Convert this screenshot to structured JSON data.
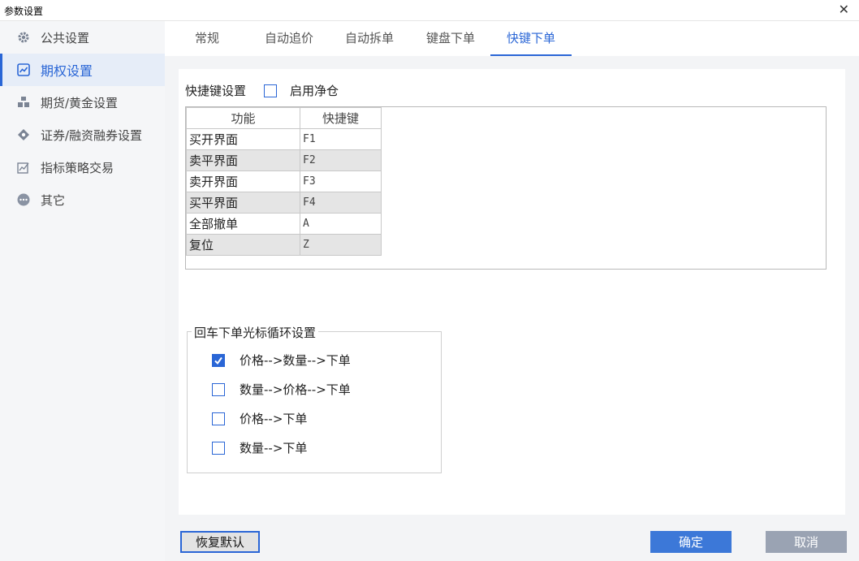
{
  "window": {
    "title": "参数设置",
    "close_glyph": "✕"
  },
  "sidebar": {
    "items": [
      {
        "label": "公共设置",
        "icon": "gear-icon"
      },
      {
        "label": "期权设置",
        "icon": "options-chart-icon",
        "active": true
      },
      {
        "label": "期货/黄金设置",
        "icon": "futures-icon"
      },
      {
        "label": "证券/融资融券设置",
        "icon": "securities-icon"
      },
      {
        "label": "指标策略交易",
        "icon": "strategy-chart-icon"
      },
      {
        "label": "其它",
        "icon": "more-icon"
      }
    ]
  },
  "tabs": [
    {
      "label": "常规"
    },
    {
      "label": "自动追价"
    },
    {
      "label": "自动拆单"
    },
    {
      "label": "键盘下单"
    },
    {
      "label": "快键下单",
      "active": true
    }
  ],
  "hotkey": {
    "section_label": "快捷键设置",
    "clean_position_label": "启用净仓",
    "clean_position_checked": false,
    "columns": [
      "功能",
      "快捷键"
    ],
    "rows": [
      {
        "func": "买开界面",
        "key": "F1"
      },
      {
        "func": "卖平界面",
        "key": "F2"
      },
      {
        "func": "卖开界面",
        "key": "F3"
      },
      {
        "func": "买平界面",
        "key": "F4"
      },
      {
        "func": "全部撤单",
        "key": "A"
      },
      {
        "func": "复位",
        "key": "Z"
      }
    ]
  },
  "cursor_cycle": {
    "legend": "回车下单光标循环设置",
    "options": [
      {
        "label": "价格-->数量-->下单",
        "checked": true
      },
      {
        "label": "数量-->价格-->下单",
        "checked": false
      },
      {
        "label": "价格-->下单",
        "checked": false
      },
      {
        "label": "数量-->下单",
        "checked": false
      }
    ]
  },
  "buttons": {
    "reset": "恢复默认",
    "ok": "确定",
    "cancel": "取消"
  },
  "colors": {
    "accent": "#2a66d6",
    "ok_button": "#3c78d8",
    "cancel_button": "#9aa3b3",
    "sidebar_bg": "#f5f6f8",
    "content_bg": "#f3f4f6"
  }
}
